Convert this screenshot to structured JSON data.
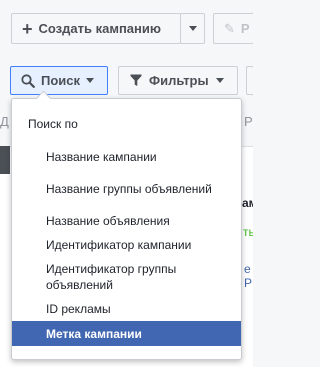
{
  "toolbar": {
    "create_label": "Создать кампанию",
    "edit_label": "Р",
    "search_label": "Поиск",
    "filter_label": "Фильтры"
  },
  "background": {
    "left_fragment": "Д",
    "right_fragment": "Р",
    "col_header_fragment": "ампа",
    "cell_fragment_1": "ть",
    "cell_fragment_2": "е Р"
  },
  "search_menu": {
    "header": "Поиск по",
    "items": [
      {
        "label": "Название кампании",
        "selected": false
      },
      {
        "label": "Название группы объявлений",
        "selected": false
      },
      {
        "label": "Название объявления",
        "selected": false
      },
      {
        "label": "Идентификатор кампании",
        "selected": false
      },
      {
        "label": "Идентификатор группы объявлений",
        "selected": false
      },
      {
        "label": "ID рекламы",
        "selected": false
      },
      {
        "label": "Метка кампании",
        "selected": true
      }
    ]
  },
  "colors": {
    "accent": "#4267b2",
    "search_active_border": "#4080ff",
    "text": "#1d2129"
  },
  "icons": {
    "create": "plus-icon",
    "edit": "pencil-icon",
    "search": "magnifier-icon",
    "filter": "funnel-icon",
    "dropdown": "caret-down-icon"
  }
}
